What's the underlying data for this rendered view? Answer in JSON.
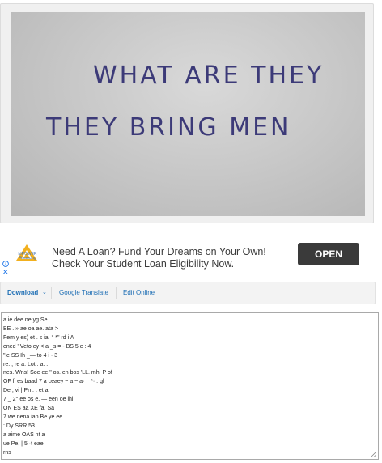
{
  "photo": {
    "line1": "WHAT ARE THEY",
    "line2": "THEY BRING MEN"
  },
  "ad": {
    "logo_text": "bIPOWER",
    "logo_subtext": "Financing",
    "headline": "Need A Loan? Fund Your Dreams on Your Own!",
    "subline": "Check Your Student Loan Eligibility Now.",
    "open_label": "OPEN",
    "close_label": "✕"
  },
  "toolbar": {
    "download_label": "Download",
    "download_caret": "⌄",
    "translate_label": "Google Translate",
    "edit_label": "Edit Online"
  },
  "ocr": {
    "lines": [
      "a ie dee ne yg Se",
      "BE . » ae oa ae. ata >",
      "Fem y es) et . s ia: ° *\" rd i A",
      "ened ' Veto ey < a _s = - BS 5 e : 4",
      "\"ie SS Ih _— to 4 i · 3",
      "re. ; re a: Lot . a. .",
      "nes. Wns! Soe ee \" os. en bos 'LL. mh. P of",
      "OF fi es baad 7 a ceaey ~ a ~ a· _ *· . gl",
      "De ; vi | Pn . . et a",
      "7 _ 2° ee os e. — een oe lhl",
      "ON ES aa XE fa. Sa",
      "7 we nena ian Be ye ee",
      ": Dy SRR 53",
      "a aime OAS nt a",
      "ue Pe, | 5 ·t eae",
      "rns"
    ]
  },
  "colors": {
    "ink": "#3c3a78",
    "link": "#1f6fb5",
    "button": "#3a3a3a"
  }
}
